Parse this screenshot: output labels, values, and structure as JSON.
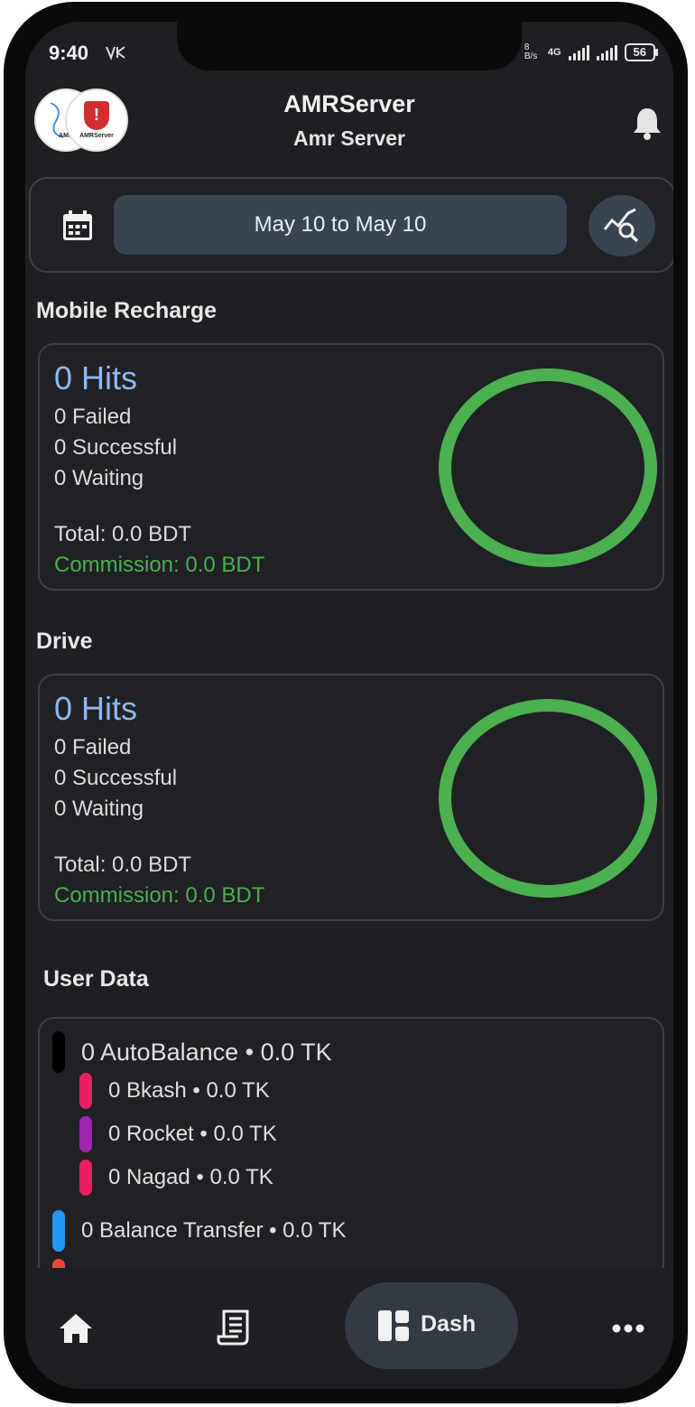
{
  "status_bar": {
    "time": "9:40",
    "left_icons": "ᵥ⁄ₛ",
    "network_speed": "8 B/s",
    "network_type": "4G",
    "battery": "56"
  },
  "header": {
    "title": "AMRServer",
    "subtitle": "Amr Server",
    "logo_text_left": "AMR",
    "logo_text_right": "AMRServer"
  },
  "date_filter": {
    "range_label": "May 10 to May 10"
  },
  "sections": {
    "mobile_recharge": {
      "title": "Mobile Recharge",
      "hits": "0 Hits",
      "failed": "0 Failed",
      "successful": "0 Successful",
      "waiting": "0 Waiting",
      "total": "Total: 0.0 BDT",
      "commission": "Commission: 0.0 BDT"
    },
    "drive": {
      "title": "Drive",
      "hits": "0 Hits",
      "failed": "0 Failed",
      "successful": "0 Successful",
      "waiting": "0 Waiting",
      "total": "Total: 0.0 BDT",
      "commission": "Commission: 0.0 BDT"
    },
    "user_data": {
      "title": "User Data",
      "items": [
        {
          "label": "0 AutoBalance • 0.0 TK",
          "color": "#000000"
        },
        {
          "label": "0 Bkash • 0.0 TK",
          "color": "#e91e63"
        },
        {
          "label": "0 Rocket • 0.0 TK",
          "color": "#9c27b0"
        },
        {
          "label": "0 Nagad • 0.0 TK",
          "color": "#e91e63"
        },
        {
          "label": "0 Balance Transfer • 0.0 TK",
          "color": "#2196f3"
        }
      ],
      "partial_item_color": "#f44336"
    }
  },
  "bottom_nav": {
    "dash_label": "Dash"
  },
  "colors": {
    "ring": "#4caf50",
    "hits": "#8fb8f0",
    "commission": "#4caf50"
  }
}
